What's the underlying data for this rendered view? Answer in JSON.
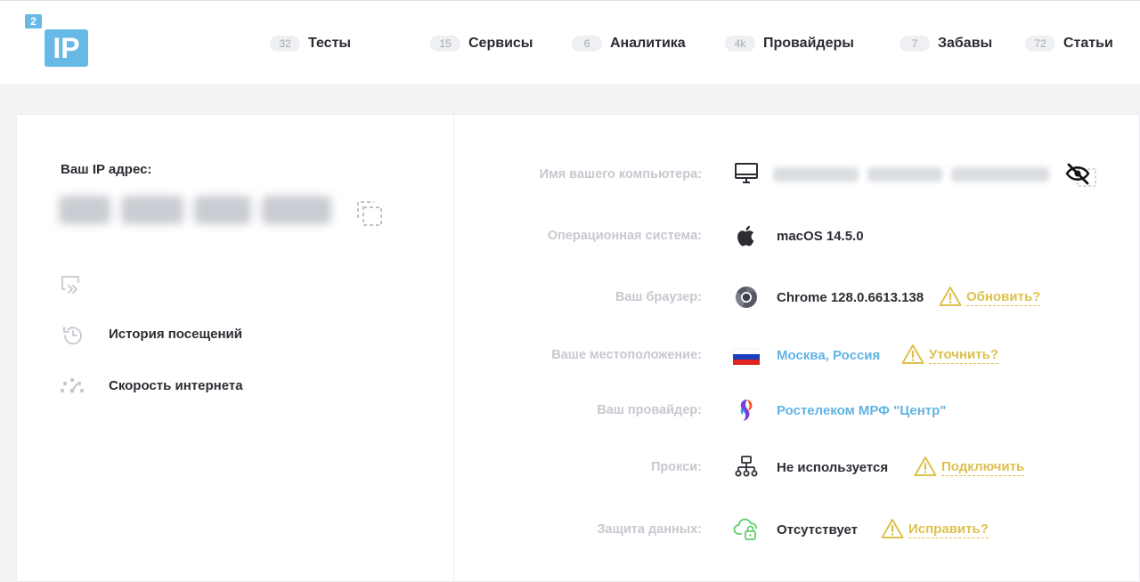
{
  "header": {
    "logo": {
      "small": "2",
      "big": "IP",
      "color": "#67b9e6"
    },
    "nav": [
      {
        "count": "32",
        "label": "Тесты"
      },
      {
        "count": "15",
        "label": "Сервисы"
      },
      {
        "count": "6",
        "label": "Аналитика"
      },
      {
        "count": "4k",
        "label": "Провайдеры"
      },
      {
        "count": "7",
        "label": "Забавы"
      },
      {
        "count": "72",
        "label": "Статьи"
      }
    ]
  },
  "left": {
    "ip_title": "Ваш IP адрес:",
    "links": [
      {
        "label": "",
        "icon": "redirect-icon"
      },
      {
        "label": "История посещений",
        "icon": "history-icon"
      },
      {
        "label": "Скорость интернета",
        "icon": "speedometer-icon"
      }
    ]
  },
  "right": {
    "rows": [
      {
        "label": "Имя вашего компьютера:",
        "icon": "monitor-icon"
      },
      {
        "label": "Операционная система:",
        "icon": "apple-icon",
        "value": "macOS 14.5.0"
      },
      {
        "label": "Ваш браузер:",
        "icon": "chrome-icon",
        "value": "Chrome 128.0.6613.138",
        "action": "Обновить?"
      },
      {
        "label": "Ваше местоположение:",
        "icon": "russia-flag-icon",
        "value": "Москва, Россия",
        "action": "Уточнить?"
      },
      {
        "label": "Ваш провайдер:",
        "icon": "rostelecom-icon",
        "value": "Ростелеком МРФ \"Центр\""
      },
      {
        "label": "Прокси:",
        "icon": "network-icon",
        "value": "Не используется",
        "action": "Подключить"
      },
      {
        "label": "Защита данных:",
        "icon": "cloud-lock-icon",
        "value": "Отсутствует",
        "action": "Исправить?"
      }
    ]
  },
  "colors": {
    "brand": "#67b9e6",
    "link_blue": "#62b3e3",
    "warning": "#ddc14d",
    "label_gray": "#c6c9cf",
    "text_dark": "#2b2d33",
    "secure_green": "#5fcf6e"
  }
}
